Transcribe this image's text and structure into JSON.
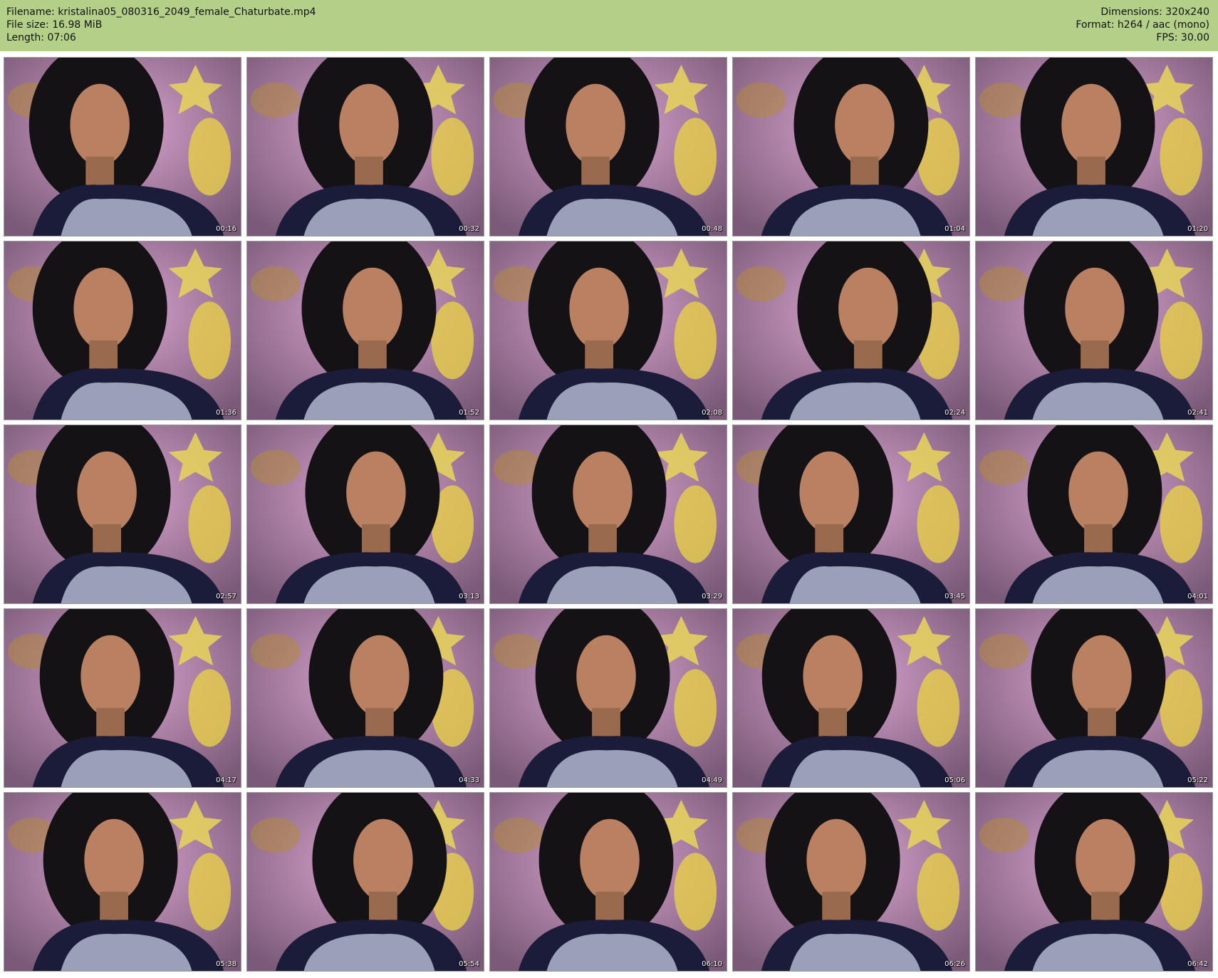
{
  "file_info": {
    "filename": "Filename: kristalina05_080316_2049_female_Chaturbate.mp4",
    "file_size": "File size: 16.98 MiB",
    "length": "Length: 07:06",
    "dimensions": "Dimensions: 320x240",
    "format": "Format: h264 / aac (mono)",
    "fps": "FPS: 30.00"
  },
  "colors": {
    "header_bg": "#b4cf87",
    "page_bg": "#ffffff",
    "pillow_pink": "#c98fc0",
    "shirt_gray": "#9aa0b8",
    "hair_dark": "#151215"
  },
  "thumbnails": [
    {
      "timestamp": "00:16"
    },
    {
      "timestamp": "00:32"
    },
    {
      "timestamp": "00:48"
    },
    {
      "timestamp": "01:04"
    },
    {
      "timestamp": "01:20"
    },
    {
      "timestamp": "01:36"
    },
    {
      "timestamp": "01:52"
    },
    {
      "timestamp": "02:08"
    },
    {
      "timestamp": "02:24"
    },
    {
      "timestamp": "02:41"
    },
    {
      "timestamp": "02:57"
    },
    {
      "timestamp": "03:13"
    },
    {
      "timestamp": "03:29"
    },
    {
      "timestamp": "03:45"
    },
    {
      "timestamp": "04:01"
    },
    {
      "timestamp": "04:17"
    },
    {
      "timestamp": "04:33"
    },
    {
      "timestamp": "04:49"
    },
    {
      "timestamp": "05:06"
    },
    {
      "timestamp": "05:22"
    },
    {
      "timestamp": "05:38"
    },
    {
      "timestamp": "05:54"
    },
    {
      "timestamp": "06:10"
    },
    {
      "timestamp": "06:26"
    },
    {
      "timestamp": "06:42"
    }
  ]
}
